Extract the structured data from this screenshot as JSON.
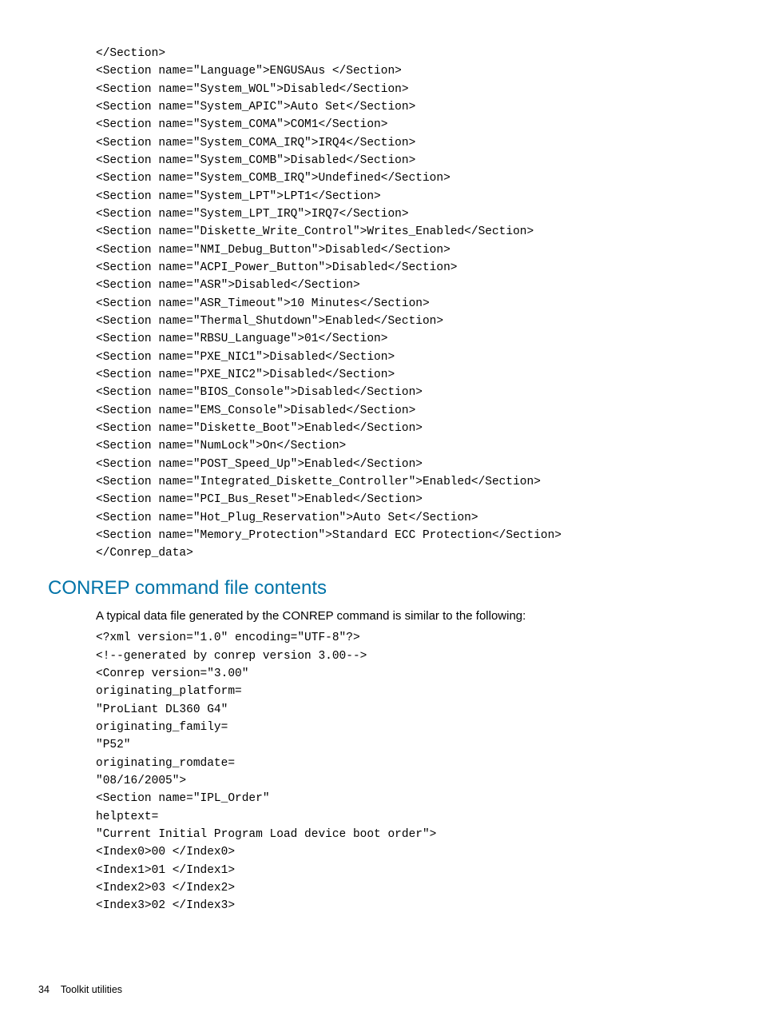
{
  "code_block_1": "</Section>\n<Section name=\"Language\">ENGUSAus </Section>\n<Section name=\"System_WOL\">Disabled</Section>\n<Section name=\"System_APIC\">Auto Set</Section>\n<Section name=\"System_COMA\">COM1</Section>\n<Section name=\"System_COMA_IRQ\">IRQ4</Section>\n<Section name=\"System_COMB\">Disabled</Section>\n<Section name=\"System_COMB_IRQ\">Undefined</Section>\n<Section name=\"System_LPT\">LPT1</Section>\n<Section name=\"System_LPT_IRQ\">IRQ7</Section>\n<Section name=\"Diskette_Write_Control\">Writes_Enabled</Section>\n<Section name=\"NMI_Debug_Button\">Disabled</Section>\n<Section name=\"ACPI_Power_Button\">Disabled</Section>\n<Section name=\"ASR\">Disabled</Section>\n<Section name=\"ASR_Timeout\">10 Minutes</Section>\n<Section name=\"Thermal_Shutdown\">Enabled</Section>\n<Section name=\"RBSU_Language\">01</Section>\n<Section name=\"PXE_NIC1\">Disabled</Section>\n<Section name=\"PXE_NIC2\">Disabled</Section>\n<Section name=\"BIOS_Console\">Disabled</Section>\n<Section name=\"EMS_Console\">Disabled</Section>\n<Section name=\"Diskette_Boot\">Enabled</Section>\n<Section name=\"NumLock\">On</Section>\n<Section name=\"POST_Speed_Up\">Enabled</Section>\n<Section name=\"Integrated_Diskette_Controller\">Enabled</Section>\n<Section name=\"PCI_Bus_Reset\">Enabled</Section>\n<Section name=\"Hot_Plug_Reservation\">Auto Set</Section>\n<Section name=\"Memory_Protection\">Standard ECC Protection</Section>\n</Conrep_data>",
  "heading": "CONREP command file contents",
  "body_paragraph": "A typical data file generated by the CONREP command is similar to the following:",
  "code_block_2": "<?xml version=\"1.0\" encoding=\"UTF-8\"?>\n<!--generated by conrep version 3.00-->\n<Conrep version=\"3.00\"\noriginating_platform=\n\"ProLiant DL360 G4\"\noriginating_family=\n\"P52\"\noriginating_romdate=\n\"08/16/2005\">\n<Section name=\"IPL_Order\"\nhelptext=\n\"Current Initial Program Load device boot order\">\n<Index0>00 </Index0>\n<Index1>01 </Index1>\n<Index2>03 </Index2>\n<Index3>02 </Index3>",
  "footer": {
    "page_number": "34",
    "section": "Toolkit utilities"
  }
}
